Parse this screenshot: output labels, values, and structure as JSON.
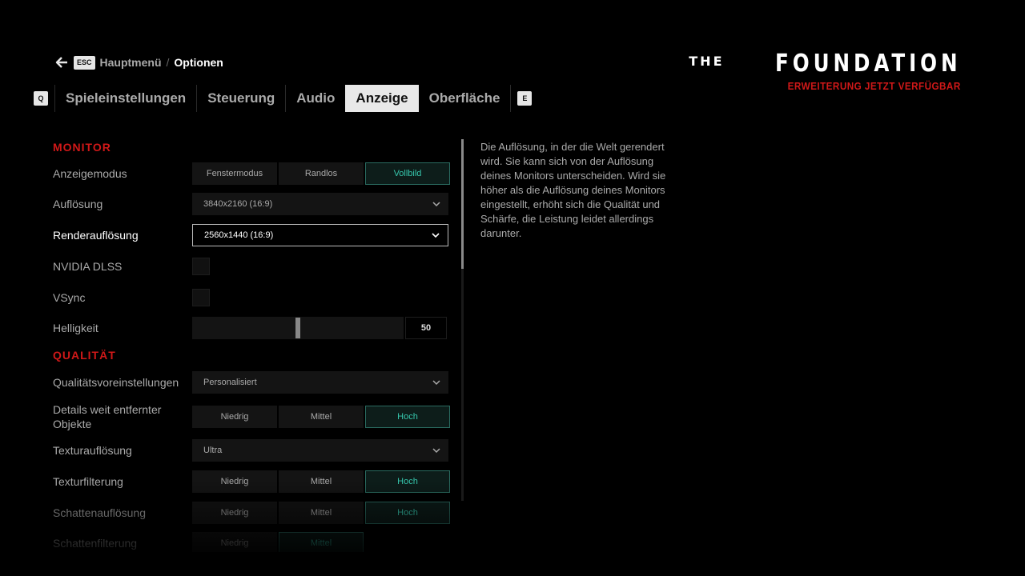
{
  "breadcrumb": {
    "esc_key": "ESC",
    "main_menu": "Hauptmenü",
    "separator": "/",
    "current": "Optionen"
  },
  "tabs": {
    "prev_key": "Q",
    "next_key": "E",
    "items": [
      {
        "label": "Spieleinstellungen",
        "active": false
      },
      {
        "label": "Steuerung",
        "active": false
      },
      {
        "label": "Audio",
        "active": false
      },
      {
        "label": "Anzeige",
        "active": true
      },
      {
        "label": "Oberfläche",
        "active": false
      }
    ]
  },
  "logo": {
    "the": "THE",
    "title": "FOUNDATION",
    "subtitle": "ERWEITERUNG JETZT VERFÜGBAR"
  },
  "sections": {
    "monitor": "MONITOR",
    "quality": "QUALITÄT"
  },
  "settings": {
    "display_mode": {
      "label": "Anzeigemodus",
      "options": [
        "Fenstermodus",
        "Randlos",
        "Vollbild"
      ],
      "selected": "Vollbild"
    },
    "resolution": {
      "label": "Auflösung",
      "value": "3840x2160 (16:9)"
    },
    "render_resolution": {
      "label": "Renderauflösung",
      "value": "2560x1440 (16:9)"
    },
    "dlss": {
      "label": "NVIDIA DLSS",
      "checked": false
    },
    "vsync": {
      "label": "VSync",
      "checked": false
    },
    "brightness": {
      "label": "Helligkeit",
      "value": "50",
      "fraction": 0.5
    },
    "quality_preset": {
      "label": "Qualitätsvoreinstellungen",
      "value": "Personalisiert"
    },
    "distant_details": {
      "label": "Details weit entfernter Objekte",
      "options": [
        "Niedrig",
        "Mittel",
        "Hoch"
      ],
      "selected": "Hoch"
    },
    "texture_resolution": {
      "label": "Texturauflösung",
      "value": "Ultra"
    },
    "texture_filtering": {
      "label": "Texturfilterung",
      "options": [
        "Niedrig",
        "Mittel",
        "Hoch"
      ],
      "selected": "Hoch"
    },
    "shadow_resolution": {
      "label": "Schattenauflösung",
      "options": [
        "Niedrig",
        "Mittel",
        "Hoch"
      ],
      "selected": "Hoch"
    },
    "shadow_filtering": {
      "label": "Schattenfilterung",
      "options": [
        "Niedrig",
        "Mittel"
      ]
    }
  },
  "description": "Die Auflösung, in der die Welt gerendert wird. Sie kann sich von der Auflösung deines Monitors unterscheiden. Wird sie höher als die Auflösung deines Monitors eingestellt, erhöht sich die Qualität und Schärfe, die Leistung leidet allerdings darunter.",
  "colors": {
    "accent_red": "#d01818",
    "selected_teal": "#36c7ad",
    "background": "#000000"
  }
}
